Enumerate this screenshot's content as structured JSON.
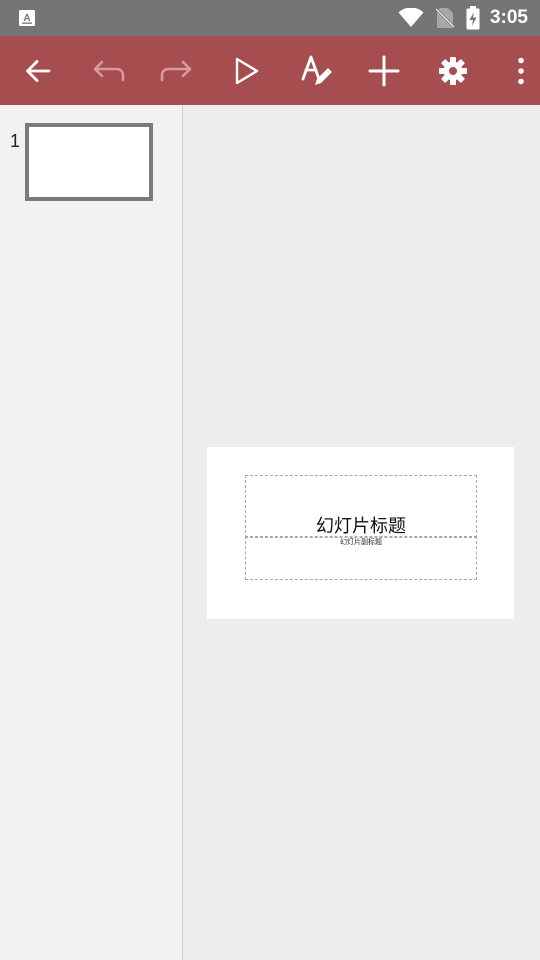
{
  "status_bar": {
    "time": "3:05",
    "icons": [
      "text-notification-icon",
      "wifi-icon",
      "no-sim-icon",
      "battery-charging-icon"
    ]
  },
  "toolbar": {
    "buttons": [
      "back-arrow-icon",
      "undo-icon",
      "redo-icon",
      "play-icon",
      "text-format-icon",
      "add-icon",
      "settings-gear-icon",
      "more-vert-icon"
    ],
    "colors": {
      "background": "#a64d4f",
      "icon": "#ffffff",
      "icon_disabled": "#d99a9b"
    }
  },
  "sidebar": {
    "slides": [
      {
        "number": "1"
      }
    ]
  },
  "slide": {
    "title_placeholder": "幻灯片标题",
    "subtitle_placeholder": "幻灯片副标题"
  }
}
